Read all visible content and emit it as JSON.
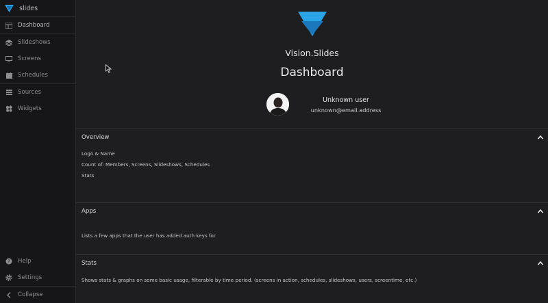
{
  "brand": {
    "label": "slides",
    "accent": "#29a3e6"
  },
  "sidebar": {
    "items": [
      {
        "label": "Dashboard",
        "icon": "dashboard-icon",
        "active": true
      },
      {
        "label": "Slideshows",
        "icon": "layers-icon"
      },
      {
        "label": "Screens",
        "icon": "monitor-icon"
      },
      {
        "label": "Schedules",
        "icon": "calendar-icon"
      },
      {
        "label": "Sources",
        "icon": "list-icon"
      },
      {
        "label": "Widgets",
        "icon": "widgets-icon"
      }
    ],
    "bottom": [
      {
        "label": "Help",
        "icon": "help-icon"
      },
      {
        "label": "Settings",
        "icon": "gear-icon"
      },
      {
        "label": "Collapse",
        "icon": "chevron-left-icon"
      }
    ]
  },
  "header": {
    "app_name": "Vision.Slides",
    "title": "Dashboard",
    "user_name": "Unknown user",
    "user_email": "unknown@email.address"
  },
  "panels": [
    {
      "title": "Overview",
      "lines": [
        "Logo & Name",
        "Count of: Members, Screens, Slideshows, Schedules",
        "Stats"
      ]
    },
    {
      "title": "Apps",
      "lines": [
        "Lists a few apps that the user has added auth keys for"
      ]
    },
    {
      "title": "Stats",
      "lines": [
        "Shows stats & graphs on some basic usage, filterable by time period. (screens in action, schedules, slideshows, users, screentime, etc.)"
      ]
    }
  ]
}
